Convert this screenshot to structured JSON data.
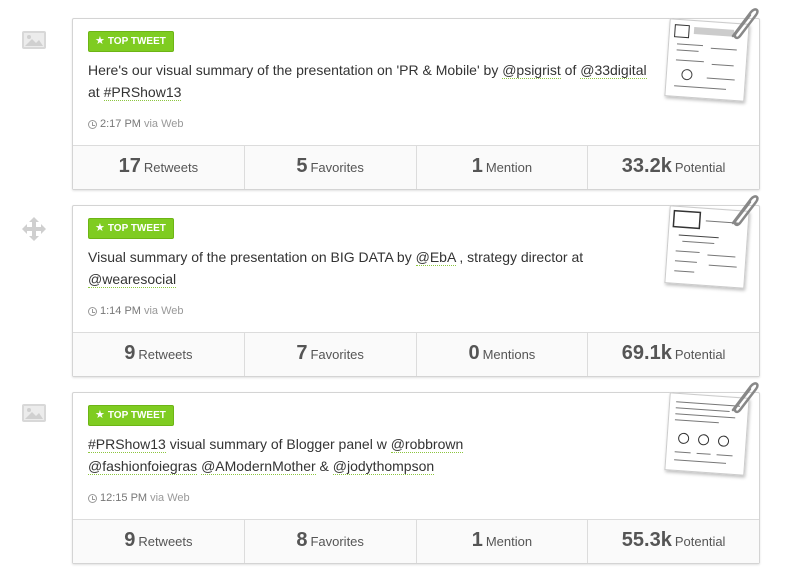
{
  "tweets": [
    {
      "badge": "TOP TWEET",
      "text_parts": [
        "Here's our visual summary of the presentation on 'PR & Mobile' by ",
        "@psigrist",
        " of ",
        "@33digital",
        " at ",
        "#PRShow13",
        ""
      ],
      "time": "2:17 PM",
      "via": "via Web",
      "stats": [
        {
          "num": "17",
          "label": "Retweets"
        },
        {
          "num": "5",
          "label": "Favorites"
        },
        {
          "num": "1",
          "label": "Mention"
        },
        {
          "num": "33.2k",
          "label": "Potential"
        }
      ]
    },
    {
      "badge": "TOP TWEET",
      "text_parts": [
        "Visual summary of the presentation on BIG DATA by ",
        "@EbA",
        " , strategy director at ",
        "@wearesocial",
        "",
        "",
        ""
      ],
      "time": "1:14 PM",
      "via": "via Web",
      "stats": [
        {
          "num": "9",
          "label": "Retweets"
        },
        {
          "num": "7",
          "label": "Favorites"
        },
        {
          "num": "0",
          "label": "Mentions"
        },
        {
          "num": "69.1k",
          "label": "Potential"
        }
      ]
    },
    {
      "badge": "TOP TWEET",
      "text_parts": [
        "#PRShow13",
        " visual summary of Blogger panel w ",
        "@robbrown",
        " ",
        "@fashionfoiegras",
        " ",
        "@AModernMother",
        " & ",
        "@jodythompson"
      ],
      "time": "12:15 PM",
      "via": "via Web",
      "stats": [
        {
          "num": "9",
          "label": "Retweets"
        },
        {
          "num": "8",
          "label": "Favorites"
        },
        {
          "num": "1",
          "label": "Mention"
        },
        {
          "num": "55.3k",
          "label": "Potential"
        }
      ]
    }
  ],
  "side_icons": [
    "image-icon",
    "move-icon",
    "image-icon"
  ]
}
